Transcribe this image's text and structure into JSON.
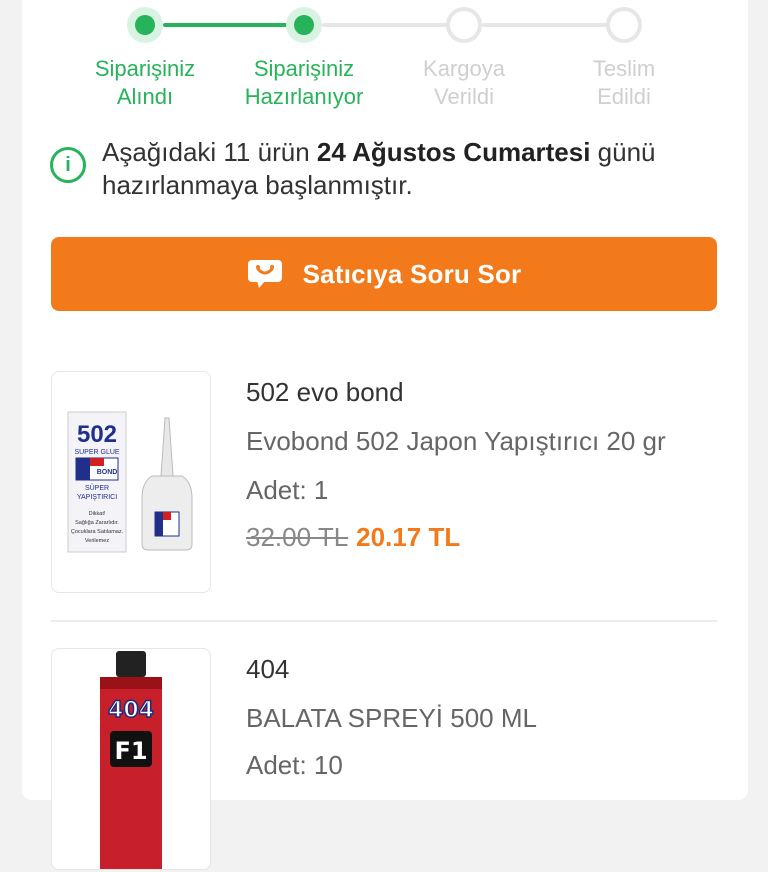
{
  "stepper": {
    "steps": [
      {
        "label": "Siparişiniz\nAlındı",
        "state": "done"
      },
      {
        "label": "Siparişiniz\nHazırlanıyor",
        "state": "done"
      },
      {
        "label": "Kargoya\nVerildi",
        "state": "todo"
      },
      {
        "label": "Teslim\nEdildi",
        "state": "todo"
      }
    ]
  },
  "info": {
    "icon": "info-circle-icon",
    "text_before": "Aşağıdaki 11 ürün ",
    "text_bold": "24 Ağustos Cumartesi",
    "text_after": " günü hazırlanmaya başlanmıştır."
  },
  "ask_button": {
    "icon": "chat-smile-icon",
    "label": "Satıcıya Soru Sor"
  },
  "products": [
    {
      "brand": "502 evo bond",
      "name": "Evobond 502 Japon Yapıştırıcı 20 gr",
      "qty": "Adet: 1",
      "old_price": "32.00 TL",
      "new_price": "20.17 TL",
      "thumb": {
        "box_code": "502",
        "box_line1": "SUPER GLUE",
        "box_brand": "BOND",
        "box_line2": "SÜPER",
        "box_line3": "YAPIŞTIRICI",
        "warn1": "Dikkat!",
        "warn2": "Sağlığa Zararlıdır.",
        "warn3": "Çocuklara Satılamaz.",
        "warn4": "Verilemez"
      }
    },
    {
      "brand": "404",
      "name": "BALATA SPREYİ 500 ML",
      "qty": "Adet: 10",
      "thumb": {
        "logo": "404",
        "badge": "F1"
      }
    }
  ],
  "colors": {
    "accent_green": "#27b35a",
    "accent_orange": "#f27a1a"
  }
}
